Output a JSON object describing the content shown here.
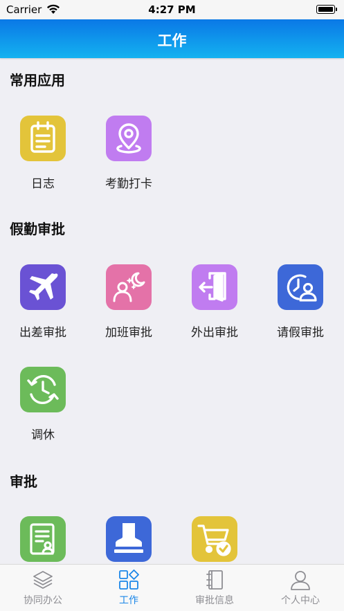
{
  "status_bar": {
    "carrier": "Carrier",
    "time": "4:27 PM"
  },
  "nav": {
    "title": "工作"
  },
  "sections": [
    {
      "title": "常用应用",
      "items": [
        {
          "label": "日志",
          "icon": "notepad-icon",
          "color": "#e3c43a"
        },
        {
          "label": "考勤打卡",
          "icon": "location-pin-icon",
          "color": "#c07cf0"
        }
      ]
    },
    {
      "title": "假勤审批",
      "items": [
        {
          "label": "出差审批",
          "icon": "airplane-icon",
          "color": "#6a52d4"
        },
        {
          "label": "加班审批",
          "icon": "night-person-icon",
          "color": "#e472a8"
        },
        {
          "label": "外出审批",
          "icon": "exit-door-icon",
          "color": "#c07cf0"
        },
        {
          "label": "请假审批",
          "icon": "clock-person-icon",
          "color": "#3d68d8"
        },
        {
          "label": "调休",
          "icon": "clock-cycle-icon",
          "color": "#6cbb5a"
        }
      ]
    },
    {
      "title": "审批",
      "items": [
        {
          "label": "",
          "icon": "document-person-icon",
          "color": "#6cbb5a"
        },
        {
          "label": "",
          "icon": "stamp-icon",
          "color": "#3d68d8"
        },
        {
          "label": "",
          "icon": "cart-check-icon",
          "color": "#e3c43a"
        }
      ]
    }
  ],
  "tabs": [
    {
      "label": "协同办公",
      "icon": "layers-icon",
      "active": false
    },
    {
      "label": "工作",
      "icon": "grid-icon",
      "active": true
    },
    {
      "label": "审批信息",
      "icon": "notebook-icon",
      "active": false
    },
    {
      "label": "个人中心",
      "icon": "person-icon",
      "active": false
    }
  ]
}
